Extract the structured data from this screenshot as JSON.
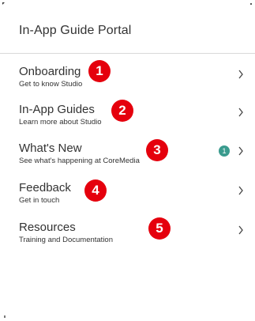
{
  "header": {
    "title": "In-App Guide Portal"
  },
  "items": [
    {
      "title": "Onboarding",
      "subtitle": "Get to know Studio",
      "marker": "1"
    },
    {
      "title": "In-App Guides",
      "subtitle": "Learn more about Studio",
      "marker": "2"
    },
    {
      "title": "What's New",
      "subtitle": "See what's happening at CoreMedia",
      "marker": "3",
      "count": "1"
    },
    {
      "title": "Feedback",
      "subtitle": "Get in touch",
      "marker": "4"
    },
    {
      "title": "Resources",
      "subtitle": "Training and Documentation",
      "marker": "5"
    }
  ],
  "colors": {
    "marker": "#e5000d",
    "count_badge": "#3a9b8e",
    "text": "#333333",
    "divider": "#d9d9d9"
  },
  "icons": {
    "chevron": "chevron-right-icon"
  }
}
